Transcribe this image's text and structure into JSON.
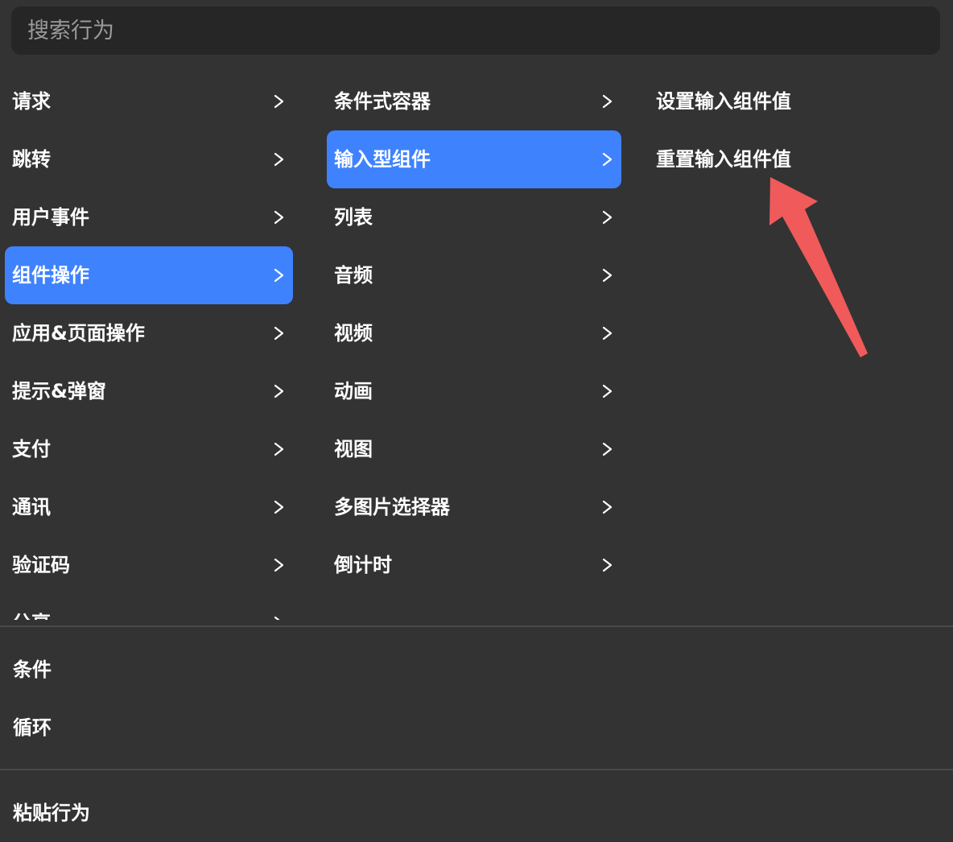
{
  "search": {
    "placeholder": "搜索行为"
  },
  "categories": [
    {
      "label": "请求",
      "active": false
    },
    {
      "label": "跳转",
      "active": false
    },
    {
      "label": "用户事件",
      "active": false
    },
    {
      "label": "组件操作",
      "active": true
    },
    {
      "label": "应用&页面操作",
      "active": false
    },
    {
      "label": "提示&弹窗",
      "active": false
    },
    {
      "label": "支付",
      "active": false
    },
    {
      "label": "通讯",
      "active": false
    },
    {
      "label": "验证码",
      "active": false
    },
    {
      "label": "分享",
      "active": false
    }
  ],
  "subcategories": [
    {
      "label": "条件式容器",
      "active": false
    },
    {
      "label": "输入型组件",
      "active": true
    },
    {
      "label": "列表",
      "active": false
    },
    {
      "label": "音频",
      "active": false
    },
    {
      "label": "视频",
      "active": false
    },
    {
      "label": "动画",
      "active": false
    },
    {
      "label": "视图",
      "active": false
    },
    {
      "label": "多图片选择器",
      "active": false
    },
    {
      "label": "倒计时",
      "active": false
    }
  ],
  "actions": [
    {
      "label": "设置输入组件值"
    },
    {
      "label": "重置输入组件值"
    }
  ],
  "logic": {
    "condition_label": "条件",
    "loop_label": "循环"
  },
  "paste": {
    "label": "粘贴行为"
  },
  "colors": {
    "background": "#333333",
    "search_bg": "#262626",
    "accent": "#3f82fe",
    "divider": "#4a4a4a",
    "annotation_arrow": "#f05a5a"
  }
}
